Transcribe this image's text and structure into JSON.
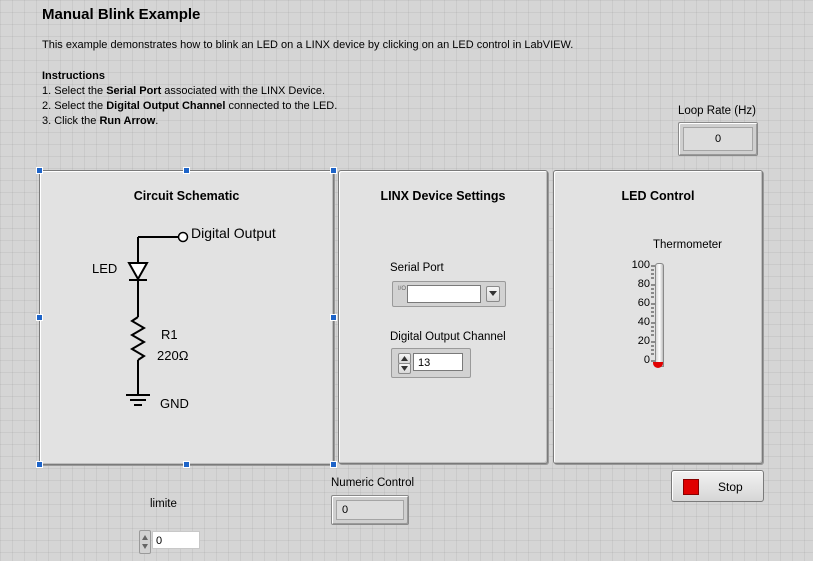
{
  "header": {
    "title": "Manual Blink Example",
    "description": "This example demonstrates how to blink an LED on a LINX device by clicking on an LED control in LabVIEW."
  },
  "instructions": {
    "heading": "Instructions",
    "steps": [
      {
        "prefix": "1. Select the ",
        "bold": "Serial Port",
        "suffix": " associated with the LINX Device."
      },
      {
        "prefix": "2. Select the ",
        "bold": "Digital Output Channel",
        "suffix": " connected to the LED."
      },
      {
        "prefix": "3. Click the ",
        "bold": "Run Arrow",
        "suffix": "."
      }
    ]
  },
  "loop_rate": {
    "label": "Loop Rate (Hz)",
    "value": "0"
  },
  "schematic": {
    "title": "Circuit Schematic",
    "digital_output": "Digital Output",
    "led": "LED",
    "r1": "R1",
    "resistance": "220Ω",
    "gnd": "GND"
  },
  "linx": {
    "title": "LINX Device Settings",
    "serial_port_label": "Serial Port",
    "serial_port_value": "",
    "io_glyph": "I/O",
    "dropdown_icon": "chevron-down-icon",
    "doc_label": "Digital Output Channel",
    "doc_value": "13"
  },
  "led_control": {
    "title": "LED Control",
    "thermometer_label": "Thermometer",
    "scale": [
      "100",
      "80",
      "60",
      "40",
      "20",
      "0"
    ],
    "level": 0
  },
  "numeric_control": {
    "label": "Numeric Control",
    "value": "0"
  },
  "limite": {
    "label": "limite",
    "value": "0"
  },
  "stop": {
    "label": "Stop",
    "color": "#e00000"
  }
}
